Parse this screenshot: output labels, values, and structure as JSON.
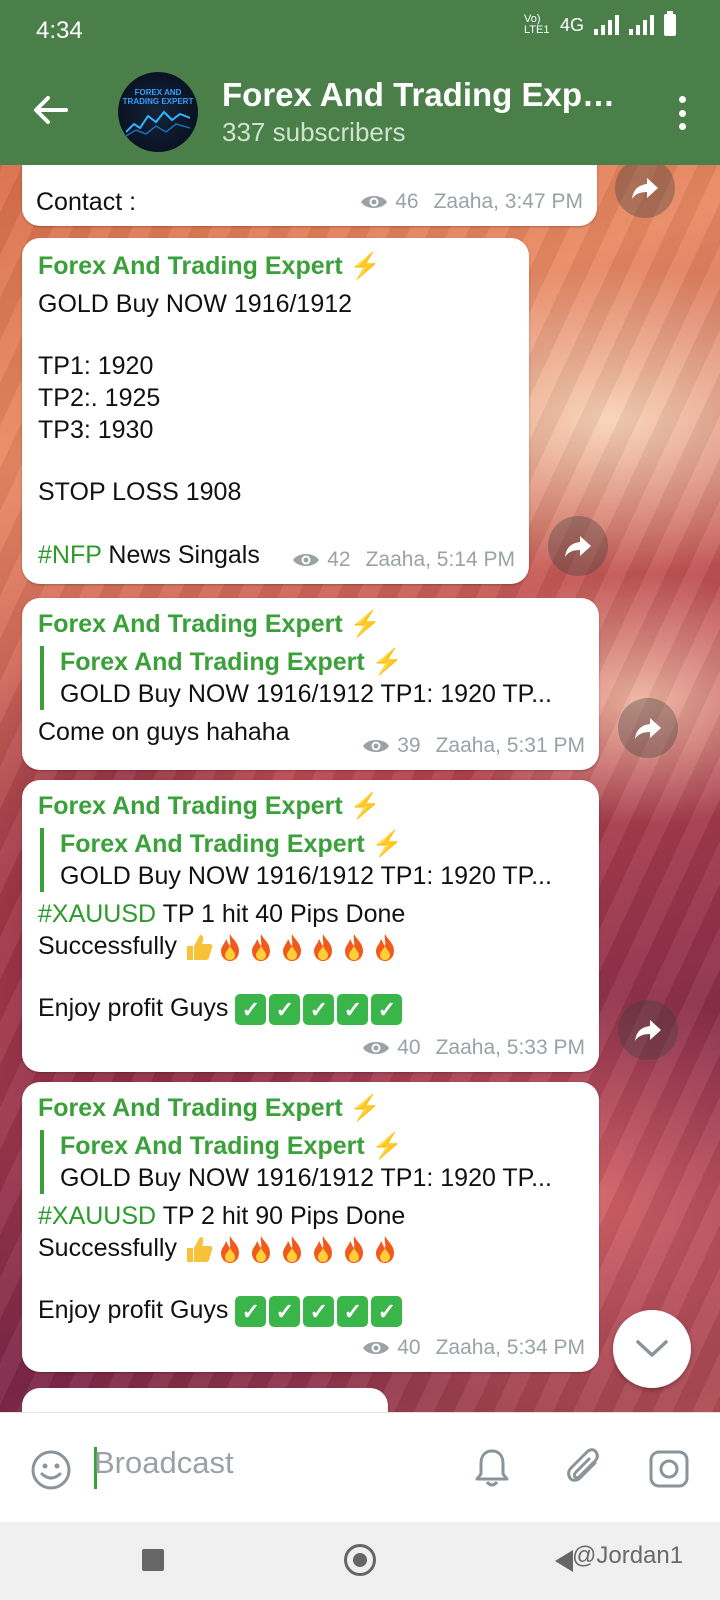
{
  "status_bar": {
    "time": "4:34",
    "network": "4G",
    "volte": "Vo) LTE1"
  },
  "header": {
    "title": "Forex And Trading Expert...",
    "subtitle": "337 subscribers",
    "avatar_text": "FOREX AND TRADING EXPERT"
  },
  "messages": [
    {
      "text": "Contact :",
      "views": "46",
      "meta": "Zaaha, 3:47 PM"
    },
    {
      "author": "Forex And Trading Expert",
      "lines": [
        "GOLD  Buy NOW 1916/1912",
        "",
        "TP1:  1920",
        "TP2:. 1925",
        "TP3:  1930",
        "",
        "STOP LOSS 1908"
      ],
      "hashtag": "#NFP",
      "hashtag_rest": " News Singals",
      "views": "42",
      "meta": "Zaaha, 5:14 PM"
    },
    {
      "author": "Forex And Trading Expert",
      "reply_author": "Forex And Trading Expert",
      "reply_text": "GOLD  Buy NOW 1916/1912  TP1:  1920 TP...",
      "text": "Come on guys hahaha",
      "views": "39",
      "meta": "Zaaha, 5:31 PM"
    },
    {
      "author": "Forex And Trading Expert",
      "reply_author": "Forex And Trading Expert",
      "reply_text": "GOLD  Buy NOW 1916/1912  TP1:  1920 TP...",
      "hashtag": "#XAUUSD",
      "hashtag_rest": "  TP 1 hit 40 Pips  Done",
      "line2": "Successfully",
      "line3": "Enjoy profit Guys",
      "views": "40",
      "meta": "Zaaha, 5:33 PM"
    },
    {
      "author": "Forex And Trading Expert",
      "reply_author": "Forex And Trading Expert",
      "reply_text": "GOLD  Buy NOW 1916/1912  TP1:  1920 TP...",
      "hashtag": "#XAUUSD",
      "hashtag_rest": "  TP 2 hit 90 Pips  Done",
      "line2": "Successfully",
      "line3": "Enjoy profit Guys",
      "views": "40",
      "meta": "Zaaha, 5:34 PM"
    }
  ],
  "input": {
    "placeholder": "Broadcast"
  },
  "watermark": "@Jordan1",
  "colors": {
    "header_bg": "#4a7f49",
    "author": "#3aa03a",
    "hashtag": "#2c9b2c",
    "meta": "#9aa2a6"
  }
}
